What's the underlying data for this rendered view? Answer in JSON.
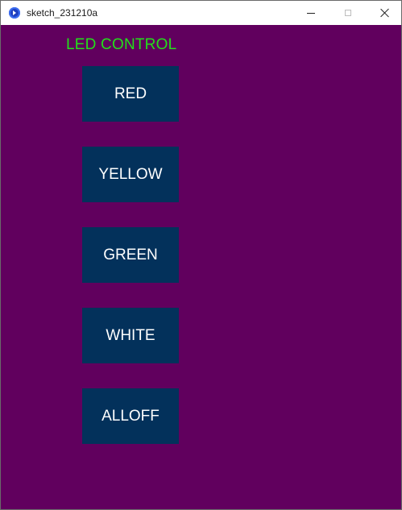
{
  "window": {
    "title": "sketch_231210a"
  },
  "canvas": {
    "heading": "LED CONTROL",
    "background_color": "#61005e",
    "heading_color": "#22e01a",
    "button_color": "#03315b",
    "buttons": [
      {
        "label": "RED"
      },
      {
        "label": "YELLOW"
      },
      {
        "label": "GREEN"
      },
      {
        "label": "WHITE"
      },
      {
        "label": "ALLOFF"
      }
    ]
  }
}
